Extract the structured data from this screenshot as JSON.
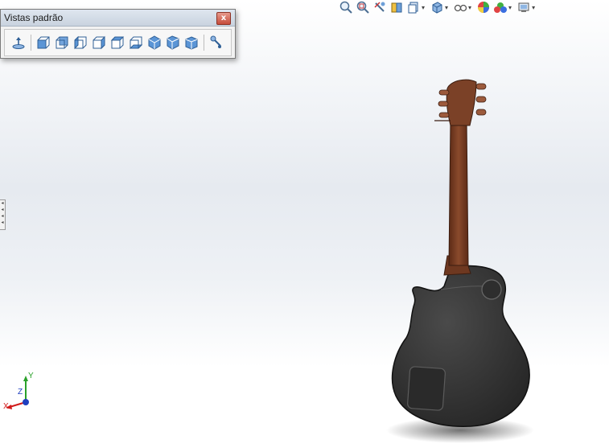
{
  "toolbar_window": {
    "title": "Vistas padrão",
    "close_label": "x",
    "buttons": [
      {
        "name": "normal-to-icon"
      },
      {
        "name": "front-view-icon"
      },
      {
        "name": "back-view-icon"
      },
      {
        "name": "left-view-icon"
      },
      {
        "name": "right-view-icon"
      },
      {
        "name": "top-view-icon"
      },
      {
        "name": "bottom-view-icon"
      },
      {
        "name": "isometric-view-icon"
      },
      {
        "name": "trimetric-view-icon"
      },
      {
        "name": "dimetric-view-icon"
      },
      {
        "name": "view-selector-icon"
      }
    ]
  },
  "headsup_toolbar": {
    "items": [
      "zoom-to-fit-icon",
      "zoom-to-area-icon",
      "previous-view-icon",
      "section-view-icon",
      "view-orientation-icon",
      "display-style-icon",
      "hide-show-items-icon",
      "edit-appearance-icon",
      "apply-scene-icon",
      "view-settings-icon"
    ]
  },
  "triad": {
    "x_label": "X",
    "y_label": "Y",
    "z_label": "Z"
  },
  "colors": {
    "x_axis": "#d11b1b",
    "y_axis": "#2aa12a",
    "z_axis": "#1f3fbf",
    "guitar_body": "#3b3b3b",
    "guitar_neck": "#7a3f24"
  }
}
